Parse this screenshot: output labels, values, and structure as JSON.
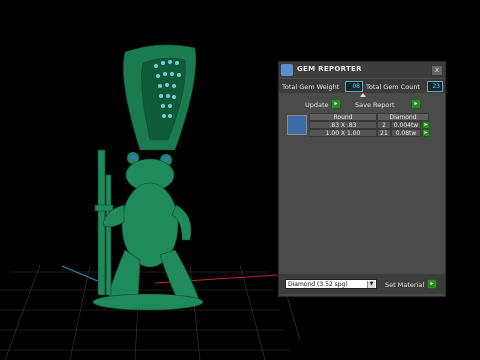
{
  "panel": {
    "title": "GEM REPORTER",
    "close_label": "x",
    "total_gem_weight_label": "Total Gem Weight",
    "total_gem_weight_value": "08",
    "total_gem_count_label": "Total Gem Count",
    "total_gem_count_value": "23",
    "update_label": "Update",
    "save_report_label": "Save Report",
    "table": {
      "headers": [
        "Round",
        "Diamond"
      ],
      "rows": [
        {
          "size": ".83 X .83",
          "count": "2",
          "weight": "0.004tw"
        },
        {
          "size": "1.00 X 1.00",
          "count": "21",
          "weight": "0.08tw"
        }
      ]
    },
    "material_value": "Diamond    (3.52 spg)",
    "set_material_label": "Set Material"
  },
  "colors": {
    "model": "#1f8a5c",
    "accent_green": "#2e8a2a",
    "panel_bg": "#4b4b4b"
  }
}
